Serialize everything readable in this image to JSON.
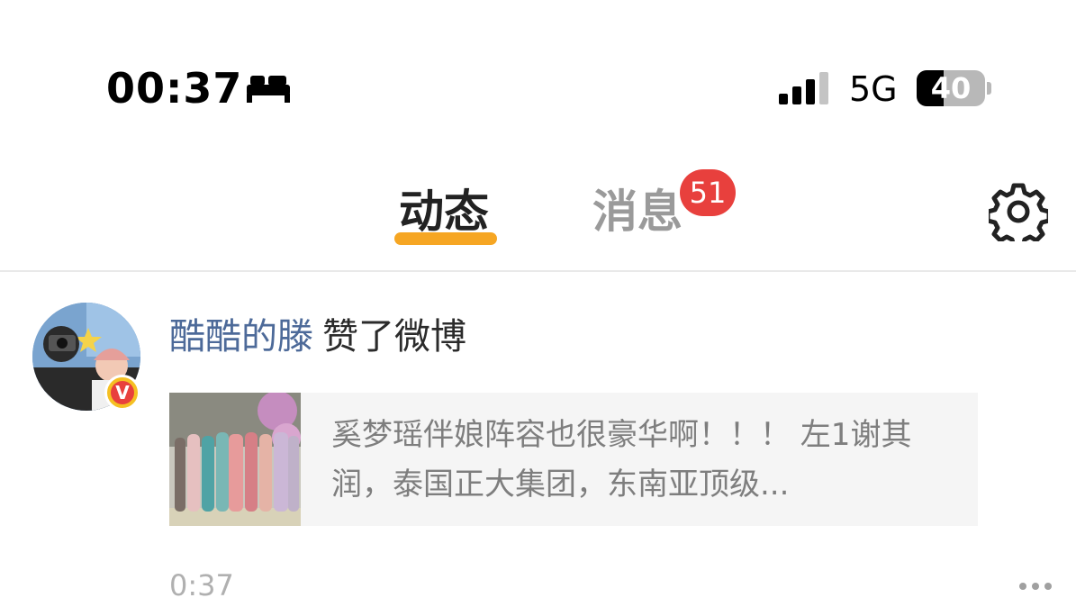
{
  "status_bar": {
    "time": "00:37",
    "mode_icon": "bed-icon",
    "signal_icon": "cellular-signal-icon",
    "network": "5G",
    "battery": "40",
    "battery_level": 0.4
  },
  "tabs": [
    {
      "label": "动态",
      "active": true
    },
    {
      "label": "消息",
      "active": false,
      "badge": "51"
    }
  ],
  "header": {
    "settings_icon": "gear-icon"
  },
  "colors": {
    "accent": "#f6a623",
    "badge": "#e8403d",
    "username": "#4d6a99",
    "verified": "#f5c023"
  },
  "feed": [
    {
      "avatar_icon": "avatar",
      "verified_badge": "V",
      "username": "酷酷的滕",
      "action": "赞了微博",
      "card": {
        "text": "奚梦瑶伴娘阵容也很豪华啊！！！ 左1谢其润，泰国正大集团，东南亚顶级..."
      },
      "time": "0:37",
      "more_icon": "more-icon"
    }
  ]
}
